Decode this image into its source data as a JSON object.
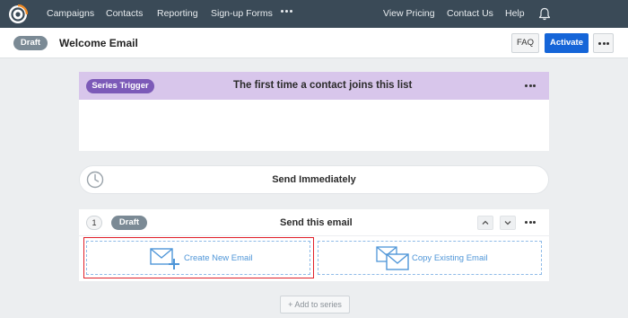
{
  "nav": {
    "items": [
      "Campaigns",
      "Contacts",
      "Reporting",
      "Sign-up Forms"
    ],
    "right_items": [
      "View Pricing",
      "Contact Us",
      "Help"
    ],
    "more_icon": "ellipsis-icon",
    "bell_icon": "bell-icon",
    "logo_icon": "constant-contact-logo"
  },
  "header": {
    "status": "Draft",
    "title": "Welcome Email",
    "faq_label": "FAQ",
    "activate_label": "Activate",
    "more_icon": "ellipsis-icon"
  },
  "trigger": {
    "badge": "Series Trigger",
    "title": "The first time a contact joins this list",
    "menu_icon": "ellipsis-icon"
  },
  "send_immediately": {
    "icon": "clock-icon",
    "label": "Send Immediately"
  },
  "email_step": {
    "number": "1",
    "status": "Draft",
    "title": "Send this email",
    "up_icon": "chevron-up-icon",
    "down_icon": "chevron-down-icon",
    "menu_icon": "ellipsis-icon",
    "create_label": "Create New Email",
    "create_icon": "envelope-plus-icon",
    "copy_label": "Copy Existing Email",
    "copy_icon": "envelopes-copy-icon"
  },
  "add_series_label": "+ Add to series",
  "colors": {
    "nav_bg": "#3a4a57",
    "trigger_bg": "#d8c6eb",
    "trigger_pill": "#7c5ab8",
    "activate": "#1565d8",
    "link_blue": "#4f96d8",
    "selection_red": "#e0202a"
  }
}
